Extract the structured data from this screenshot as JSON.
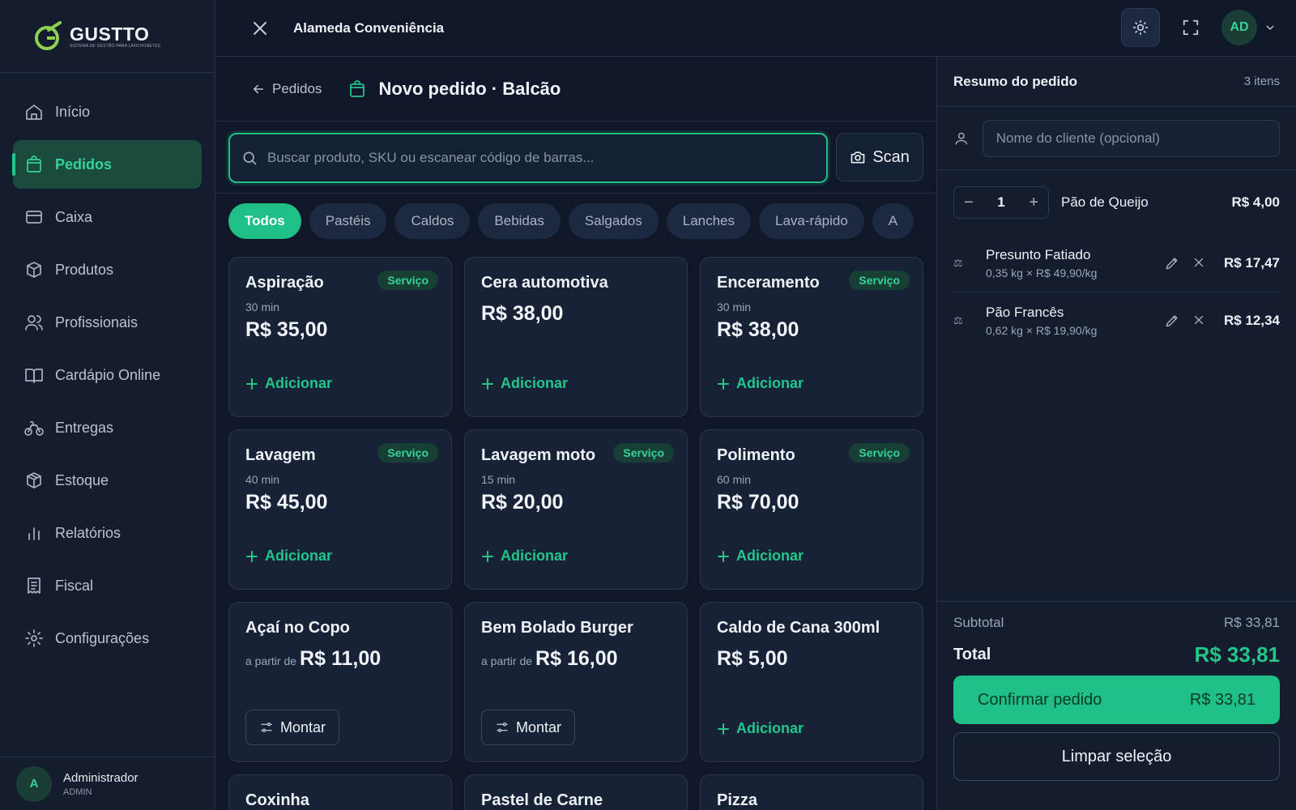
{
  "brand": {
    "name": "GUSTTO",
    "tagline": "SISTEMA DE GESTÃO PARA LANCHONETES",
    "accent": "#22c58a"
  },
  "sidebar": {
    "items": [
      {
        "label": "Início",
        "icon": "home-icon",
        "active": false
      },
      {
        "label": "Pedidos",
        "icon": "shopping-bag-icon",
        "active": true
      },
      {
        "label": "Caixa",
        "icon": "credit-card-icon",
        "active": false
      },
      {
        "label": "Produtos",
        "icon": "package-icon",
        "active": false
      },
      {
        "label": "Profissionais",
        "icon": "users-icon",
        "active": false
      },
      {
        "label": "Cardápio Online",
        "icon": "book-open-icon",
        "active": false
      },
      {
        "label": "Entregas",
        "icon": "bike-icon",
        "active": false
      },
      {
        "label": "Estoque",
        "icon": "box-icon",
        "active": false
      },
      {
        "label": "Relatórios",
        "icon": "bar-chart-icon",
        "active": false
      },
      {
        "label": "Fiscal",
        "icon": "receipt-icon",
        "active": false
      },
      {
        "label": "Configurações",
        "icon": "gear-icon",
        "active": false
      }
    ],
    "user": {
      "initial": "A",
      "name": "Administrador",
      "role": "ADMIN"
    }
  },
  "topbar": {
    "store_name": "Alameda Conveniência",
    "avatar_initials": "AD"
  },
  "page": {
    "back_label": "Pedidos",
    "title": "Novo pedido · Balcão"
  },
  "search": {
    "placeholder": "Buscar produto, SKU ou escanear código de barras...",
    "scan_label": "Scan"
  },
  "categories": [
    "Todos",
    "Pastéis",
    "Caldos",
    "Bebidas",
    "Salgados",
    "Lanches",
    "Lava-rápido",
    "A"
  ],
  "active_category": "Todos",
  "products": [
    {
      "name": "Aspiração",
      "badge": "Serviço",
      "sub": "30 min",
      "price_prefix": "",
      "price": "R$ 35,00",
      "action": "Adicionar"
    },
    {
      "name": "Cera automotiva",
      "badge": "",
      "sub": "",
      "price_prefix": "",
      "price": "R$ 38,00",
      "action": "Adicionar"
    },
    {
      "name": "Enceramento",
      "badge": "Serviço",
      "sub": "30 min",
      "price_prefix": "",
      "price": "R$ 38,00",
      "action": "Adicionar"
    },
    {
      "name": "Lavagem",
      "badge": "Serviço",
      "sub": "40 min",
      "price_prefix": "",
      "price": "R$ 45,00",
      "action": "Adicionar"
    },
    {
      "name": "Lavagem moto",
      "badge": "Serviço",
      "sub": "15 min",
      "price_prefix": "",
      "price": "R$ 20,00",
      "action": "Adicionar"
    },
    {
      "name": "Polimento",
      "badge": "Serviço",
      "sub": "60 min",
      "price_prefix": "",
      "price": "R$ 70,00",
      "action": "Adicionar"
    },
    {
      "name": "Açaí no Copo",
      "badge": "",
      "sub": "",
      "price_prefix": "a partir de",
      "price": "R$ 11,00",
      "action": "Montar"
    },
    {
      "name": "Bem Bolado Burger",
      "badge": "",
      "sub": "",
      "price_prefix": "a partir de",
      "price": "R$ 16,00",
      "action": "Montar"
    },
    {
      "name": "Caldo de Cana 300ml",
      "badge": "",
      "sub": "",
      "price_prefix": "",
      "price": "R$ 5,00",
      "action": "Adicionar"
    },
    {
      "name": "Coxinha",
      "badge": "",
      "sub": "",
      "price_prefix": "",
      "price": "",
      "action": ""
    },
    {
      "name": "Pastel de Carne",
      "badge": "",
      "sub": "",
      "price_prefix": "",
      "price": "",
      "action": ""
    },
    {
      "name": "Pizza",
      "badge": "",
      "sub": "",
      "price_prefix": "",
      "price": "",
      "action": ""
    }
  ],
  "summary": {
    "title": "Resumo do pedido",
    "count": "3 itens",
    "client_placeholder": "Nome do cliente (opcional)",
    "qty_item": {
      "qty": "1",
      "name": "Pão de Queijo",
      "price": "R$ 4,00"
    },
    "weight_items": [
      {
        "name": "Presunto Fatiado",
        "detail": "0,35 kg × R$ 49,90/kg",
        "price": "R$ 17,47"
      },
      {
        "name": "Pão Francês",
        "detail": "0,62 kg × R$ 19,90/kg",
        "price": "R$ 12,34"
      }
    ],
    "subtotal_label": "Subtotal",
    "subtotal_value": "R$ 33,81",
    "total_label": "Total",
    "total_value": "R$ 33,81",
    "confirm_label": "Confirmar pedido",
    "confirm_value": "R$ 33,81",
    "clear_label": "Limpar seleção"
  }
}
